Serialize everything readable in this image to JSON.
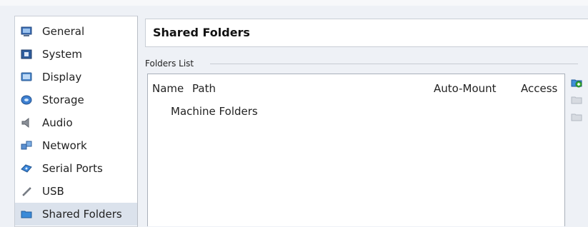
{
  "sidebar": {
    "items": [
      {
        "label": "General",
        "icon": "general-icon"
      },
      {
        "label": "System",
        "icon": "system-icon"
      },
      {
        "label": "Display",
        "icon": "display-icon"
      },
      {
        "label": "Storage",
        "icon": "storage-icon"
      },
      {
        "label": "Audio",
        "icon": "audio-icon"
      },
      {
        "label": "Network",
        "icon": "network-icon"
      },
      {
        "label": "Serial Ports",
        "icon": "serial-ports-icon"
      },
      {
        "label": "USB",
        "icon": "usb-icon"
      },
      {
        "label": "Shared Folders",
        "icon": "shared-folders-icon",
        "selected": true
      }
    ]
  },
  "main": {
    "title": "Shared Folders",
    "group_label": "Folders List",
    "table": {
      "columns": [
        "Name",
        "Path",
        "Auto-Mount",
        "Access"
      ],
      "rows": [
        "Machine Folders"
      ]
    },
    "toolbar": [
      "add-shared-folder-icon",
      "edit-shared-folder-icon",
      "remove-shared-folder-icon"
    ]
  },
  "colors": {
    "background": "#eef1f6",
    "selected_item": "#dbe2ec",
    "border": "#c9ced6"
  }
}
